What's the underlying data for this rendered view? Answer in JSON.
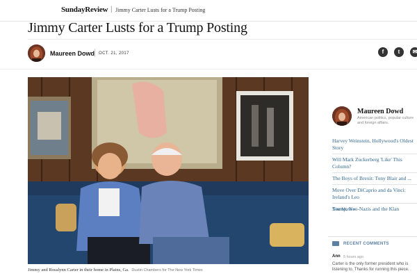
{
  "header": {
    "section": "SundayReview",
    "separator": "|",
    "article_title": "Jimmy Carter Lusts for a Trump Posting"
  },
  "article": {
    "headline": "Jimmy Carter Lusts for a Trump Posting",
    "author": "Maureen Dowd",
    "date": "OCT. 21, 2017",
    "caption": "Jimmy and Rosalynn Carter in their home in Plains, Ga.",
    "credit": "Dustin Chambers for The New York Times"
  },
  "share": {
    "facebook": "f",
    "twitter": "t",
    "email": "✉",
    "icons": [
      "facebook-icon",
      "twitter-icon",
      "email-icon"
    ]
  },
  "aside": {
    "author": "Maureen Dowd",
    "bio": "American politics, popular culture and foreign affairs.",
    "related": [
      "Harvey Weinstein, Hollywood's Oldest Story",
      "Will Mark Zuckerberg 'Like' This Column?",
      "The Boys of Brexit: Tony Blair and ...",
      "Move Over DiCaprio and da Vinci: Ireland's Leo",
      "Trump, Neo-Nazis and the Klan"
    ],
    "see_more": "See More »"
  },
  "comments": {
    "label": "RECENT COMMENTS",
    "user": "Ann",
    "time": "5 hours ago",
    "text": "Carter is the only former president who is listening to. Thanks for running this piece."
  },
  "colors": {
    "link": "#326891",
    "text": "#121212",
    "muted": "#999999",
    "comment_accent": "#5a7fa3"
  }
}
